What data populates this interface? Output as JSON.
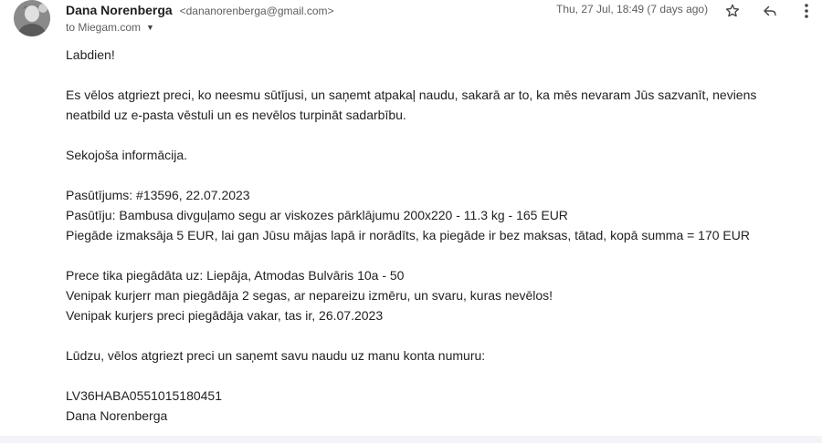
{
  "sender": {
    "name": "Dana Norenberga",
    "email": "<dananorenberga@gmail.com>",
    "to": "to Miegam.com"
  },
  "date": "Thu, 27 Jul, 18:49 (7 days ago)",
  "icons": {
    "avatar": "avatar",
    "star": "star-icon",
    "reply": "reply-icon",
    "more": "more-vert-icon",
    "caret": "chevron-down-icon"
  },
  "body": {
    "greeting": "Labdien!",
    "para1_line1": "Es vēlos atgriezt preci, ko neesmu sūtījusi, un saņemt atpakaļ naudu, sakarā ar to, ka mēs nevaram Jūs sazvanīt, neviens",
    "para1_line2": "neatbild uz e-pasta vēstuli un es nevēlos turpināt sadarbību.",
    "info": "Sekojoša informācija.",
    "order_line": "Pasūtījums: #13596, 22.07.2023",
    "ordered_line": "Pasūtīju: Bambusa divguļamo segu ar viskozes pārklājumu 200x220 - 11.3 kg  - 165 EUR",
    "delivery_cost_line": "Piegāde izmaksāja 5 EUR, lai gan Jūsu mājas lapā ir norādīts, ka piegāde ir bez maksas, tātad, kopā summa = 170 EUR",
    "delivered_to_line": "Prece tika piegādāta uz: Liepāja, Atmodas Bulvāris 10a - 50",
    "courier_line1": "Venipak kurjerr man piegādāja 2 segas, ar nepareizu izmēru, un svaru, kuras nevēlos!",
    "courier_line2": "Venipak kurjers preci piegādāja vakar, tas ir, 26.07.2023",
    "request_line": "Lūdzu, vēlos atgriezt preci un saņemt savu naudu uz manu konta numuru:",
    "account": "LV36HABA0551015180451",
    "signature": "Dana Norenberga"
  }
}
